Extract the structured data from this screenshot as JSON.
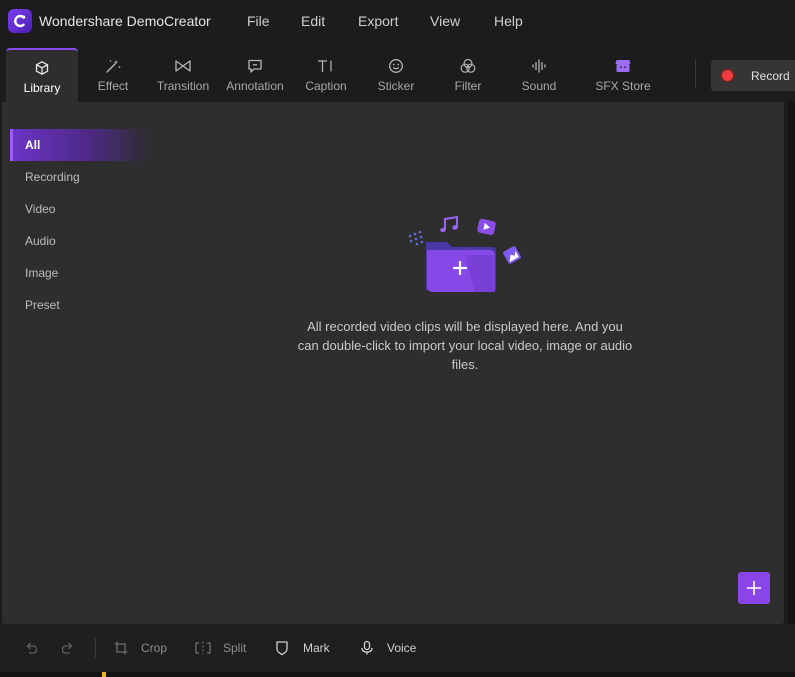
{
  "app": {
    "title": "Wondershare DemoCreator"
  },
  "menu": [
    "File",
    "Edit",
    "Export",
    "View",
    "Help"
  ],
  "toolbar": {
    "tabs": [
      {
        "label": "Library",
        "icon": "cube-icon",
        "active": true
      },
      {
        "label": "Effect",
        "icon": "magic-wand-icon",
        "active": false
      },
      {
        "label": "Transition",
        "icon": "bowtie-icon",
        "active": false
      },
      {
        "label": "Annotation",
        "icon": "speech-bubble-icon",
        "active": false
      },
      {
        "label": "Caption",
        "icon": "text-cursor-icon",
        "active": false
      },
      {
        "label": "Sticker",
        "icon": "smiley-icon",
        "active": false
      },
      {
        "label": "Filter",
        "icon": "circles-icon",
        "active": false
      },
      {
        "label": "Sound",
        "icon": "waveform-icon",
        "active": false
      },
      {
        "label": "SFX Store",
        "icon": "store-icon",
        "active": false
      }
    ],
    "record_label": "Record"
  },
  "library": {
    "categories": [
      {
        "label": "All",
        "active": true
      },
      {
        "label": "Recording",
        "active": false
      },
      {
        "label": "Video",
        "active": false
      },
      {
        "label": "Audio",
        "active": false
      },
      {
        "label": "Image",
        "active": false
      },
      {
        "label": "Preset",
        "active": false
      }
    ],
    "empty_message": "All recorded video clips will be displayed here. And you can double-click to import your local video, image or audio files."
  },
  "editbar": {
    "crop_label": "Crop",
    "split_label": "Split",
    "mark_label": "Mark",
    "voice_label": "Voice"
  },
  "colors": {
    "accent": "#8a45e6",
    "record": "#ef3b3b",
    "panel": "#2e2e2e",
    "background": "#1c1c1c"
  }
}
